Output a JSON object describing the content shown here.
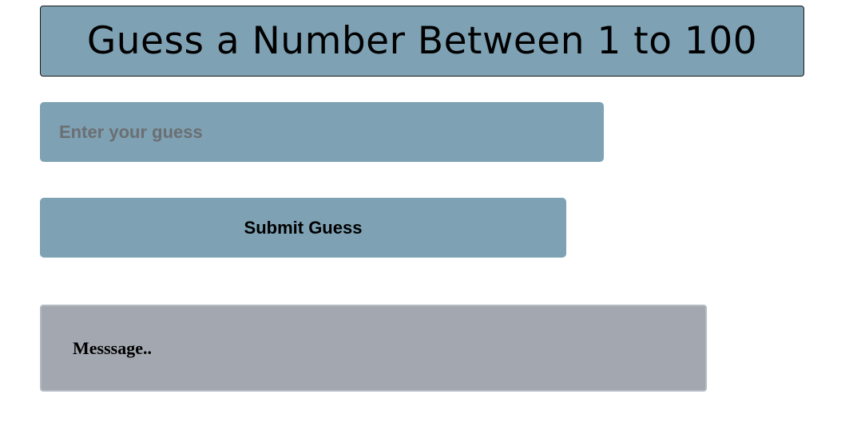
{
  "header": {
    "title": "Guess a Number Between 1 to 100"
  },
  "guess_input": {
    "value": "",
    "placeholder": "Enter your guess"
  },
  "submit_button": {
    "label": "Submit Guess"
  },
  "message": {
    "text": "Messsage.."
  },
  "colors": {
    "accent": "#7ea1b4",
    "message_bg": "#a3a8b0",
    "page_bg": "#ffffff"
  }
}
